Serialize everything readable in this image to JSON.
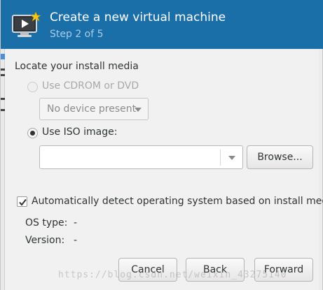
{
  "header": {
    "title": "Create a new virtual machine",
    "step": "Step 2 of 5",
    "icon": "new-vm-monitor-icon",
    "accent": "#1b6fa8"
  },
  "main": {
    "section_label": "Locate your install media",
    "cdrom_option": {
      "label": "Use CDROM or DVD",
      "selected": false,
      "disabled": true
    },
    "device_combo": {
      "value": "No device present",
      "disabled": true
    },
    "iso_option": {
      "label": "Use ISO image:",
      "selected": true
    },
    "iso_path": {
      "value": ""
    },
    "browse_label": "Browse...",
    "autodetect": {
      "label": "Automatically detect operating system based on install media",
      "checked": true
    },
    "os_type": {
      "label": "OS type:",
      "value": "-"
    },
    "version": {
      "label": "Version:",
      "value": "-"
    }
  },
  "footer": {
    "cancel_label": "Cancel",
    "back_label": "Back",
    "forward_label": "Forward"
  },
  "watermark": "https://blog.csdn.net/weixin_43275140"
}
